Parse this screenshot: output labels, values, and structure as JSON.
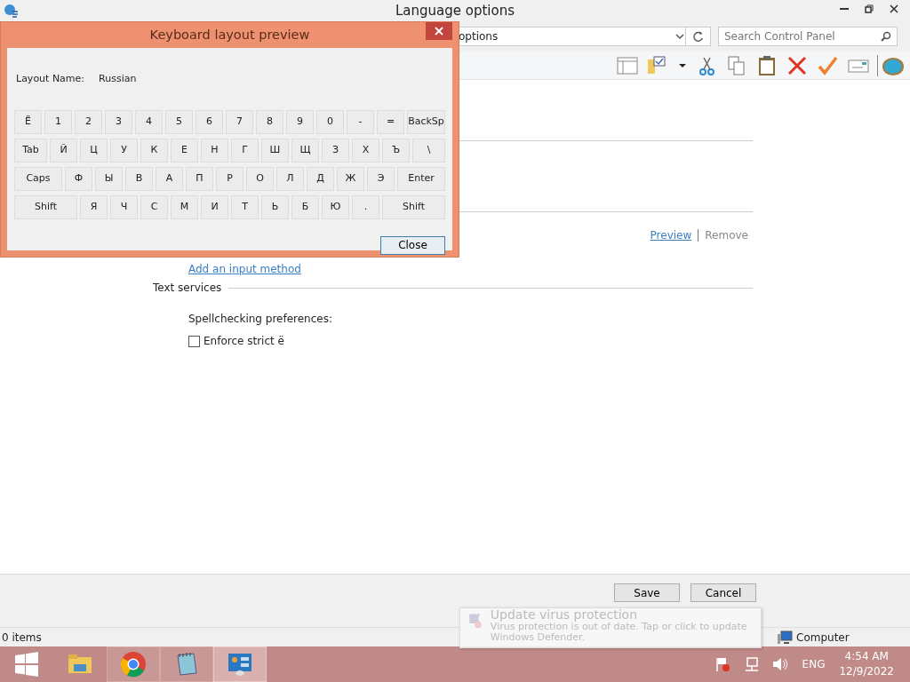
{
  "window": {
    "title": "Language options"
  },
  "address_bar": {
    "path": "options"
  },
  "search": {
    "placeholder": "Search Control Panel"
  },
  "content": {
    "section_title": "Text services",
    "link_add": "Add an input method",
    "preview_link": "Preview",
    "remove_link": "Remove",
    "spellcheck_label": "Spellchecking preferences:",
    "checkbox": {
      "label": "Enforce strict ё",
      "checked": false
    }
  },
  "buttons": [
    {
      "label": "Save"
    },
    {
      "label": "Cancel"
    }
  ],
  "status_bar": {
    "items": "0 items",
    "zone": "Computer"
  },
  "dialog": {
    "title": "Keyboard layout preview",
    "layout_label": "Layout Name:",
    "layout_value": "Russian",
    "close_button": "Close",
    "keyboard": [
      [
        {
          "label": "Ё",
          "kind": "char"
        },
        {
          "label": "1",
          "kind": "char"
        },
        {
          "label": "2",
          "kind": "char"
        },
        {
          "label": "3",
          "kind": "char"
        },
        {
          "label": "4",
          "kind": "char"
        },
        {
          "label": "5",
          "kind": "char"
        },
        {
          "label": "6",
          "kind": "char"
        },
        {
          "label": "7",
          "kind": "char"
        },
        {
          "label": "8",
          "kind": "char"
        },
        {
          "label": "9",
          "kind": "char"
        },
        {
          "label": "0",
          "kind": "char"
        },
        {
          "label": "-",
          "kind": "char"
        },
        {
          "label": "=",
          "kind": "char"
        },
        {
          "label": "BackSp",
          "kind": "wide"
        }
      ],
      [
        {
          "label": "Tab",
          "kind": "wide"
        },
        {
          "label": "Й",
          "kind": "char"
        },
        {
          "label": "Ц",
          "kind": "char"
        },
        {
          "label": "У",
          "kind": "char"
        },
        {
          "label": "К",
          "kind": "char"
        },
        {
          "label": "Е",
          "kind": "char"
        },
        {
          "label": "Н",
          "kind": "char"
        },
        {
          "label": "Г",
          "kind": "char"
        },
        {
          "label": "Ш",
          "kind": "char"
        },
        {
          "label": "Щ",
          "kind": "char"
        },
        {
          "label": "З",
          "kind": "char"
        },
        {
          "label": "Х",
          "kind": "char"
        },
        {
          "label": "Ъ",
          "kind": "char"
        },
        {
          "label": "\\",
          "kind": "wide"
        }
      ],
      [
        {
          "label": "Caps",
          "kind": "wide"
        },
        {
          "label": "Ф",
          "kind": "char"
        },
        {
          "label": "Ы",
          "kind": "char"
        },
        {
          "label": "В",
          "kind": "char"
        },
        {
          "label": "А",
          "kind": "char"
        },
        {
          "label": "П",
          "kind": "char"
        },
        {
          "label": "Р",
          "kind": "char"
        },
        {
          "label": "О",
          "kind": "char"
        },
        {
          "label": "Л",
          "kind": "char"
        },
        {
          "label": "Д",
          "kind": "char"
        },
        {
          "label": "Ж",
          "kind": "char"
        },
        {
          "label": "Э",
          "kind": "char"
        },
        {
          "label": "Enter",
          "kind": "wide"
        }
      ],
      [
        {
          "label": "Shift",
          "kind": "wide"
        },
        {
          "label": "Я",
          "kind": "char"
        },
        {
          "label": "Ч",
          "kind": "char"
        },
        {
          "label": "С",
          "kind": "char"
        },
        {
          "label": "М",
          "kind": "char"
        },
        {
          "label": "И",
          "kind": "char"
        },
        {
          "label": "Т",
          "kind": "char"
        },
        {
          "label": "Ь",
          "kind": "char"
        },
        {
          "label": "Б",
          "kind": "char"
        },
        {
          "label": "Ю",
          "kind": "char"
        },
        {
          "label": ".",
          "kind": "char"
        },
        {
          "label": "Shift",
          "kind": "wide"
        }
      ]
    ]
  },
  "notification": {
    "title": "Update virus protection",
    "text": "Virus protection is out of date. Tap or click to update Windows Defender."
  },
  "taskbar": {
    "apps": [
      {
        "kind": "folder",
        "selected": false
      },
      {
        "kind": "chrome",
        "selected": false
      },
      {
        "kind": "notepad",
        "selected": false
      },
      {
        "kind": "control",
        "selected": true
      }
    ],
    "language": "ENG",
    "time": "4:54 AM",
    "date": "12/9/2022"
  }
}
